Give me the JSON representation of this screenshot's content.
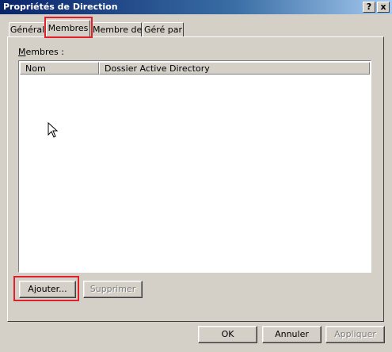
{
  "window": {
    "title": "Propriétés de Direction",
    "help_button": "?",
    "close_button": "x"
  },
  "tabs": [
    {
      "label": "Général",
      "active": false
    },
    {
      "label": "Membres",
      "active": true
    },
    {
      "label": "Membre de",
      "active": false
    },
    {
      "label": "Géré par",
      "active": false
    }
  ],
  "members": {
    "label_access_key": "M",
    "label_rest": "embres :",
    "columns": [
      "Nom",
      "Dossier Active Directory"
    ],
    "rows": []
  },
  "list_buttons": {
    "add_access_key": "j",
    "add_prefix": "A",
    "add_suffix": "outer...",
    "remove": "Supprimer"
  },
  "dialog_buttons": {
    "ok": "OK",
    "cancel": "Annuler",
    "apply": "Appliquer"
  },
  "colors": {
    "highlight": "#e0202a",
    "titlebar_start": "#0a246a",
    "face": "#d4d0c8"
  }
}
